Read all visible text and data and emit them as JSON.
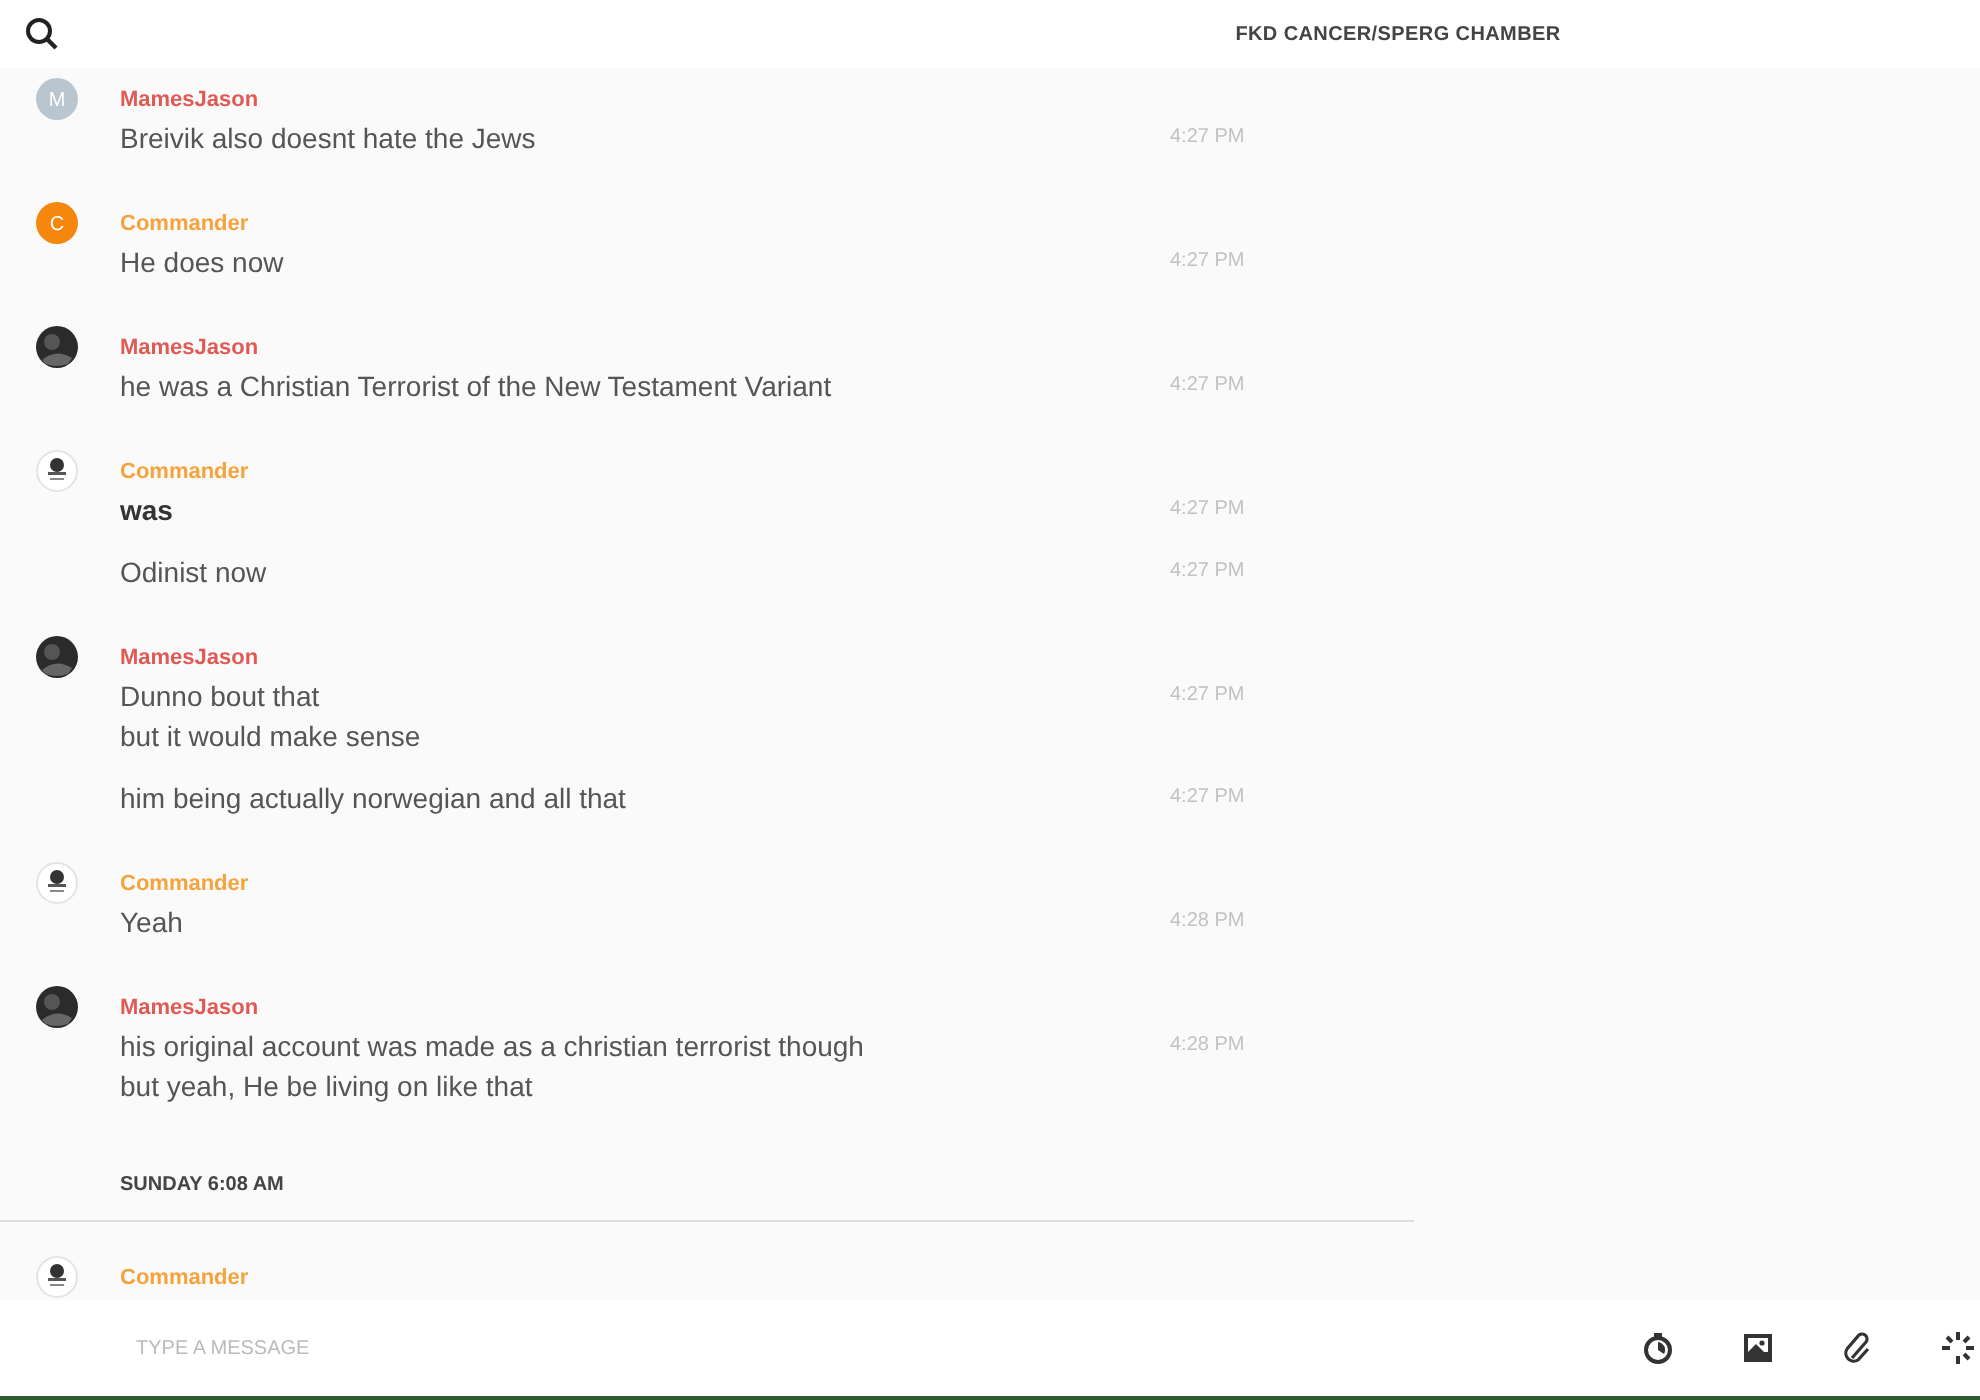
{
  "header": {
    "title": "FKD CANCER/SPERG CHAMBER"
  },
  "messages": [
    {
      "kind": "group",
      "author": "MamesJason",
      "color": "#e05a55",
      "avatar": {
        "kind": "letter",
        "letter": "M",
        "color": "#b9c6cf"
      },
      "lines": [
        {
          "text": "Breivik also doesnt hate the Jews",
          "time": "4:27 PM",
          "bold": false
        }
      ]
    },
    {
      "kind": "group",
      "author": "Commander",
      "color": "#f5a33c",
      "avatar": {
        "kind": "letter",
        "letter": "C",
        "color": "#f5870f"
      },
      "lines": [
        {
          "text": "He does now",
          "time": "4:27 PM",
          "bold": false
        }
      ]
    },
    {
      "kind": "group",
      "author": "MamesJason",
      "color": "#e05a55",
      "avatar": {
        "kind": "photo"
      },
      "lines": [
        {
          "text": "he was a Christian Terrorist of the New Testament Variant",
          "time": "4:27 PM",
          "bold": false
        }
      ]
    },
    {
      "kind": "group",
      "author": "Commander",
      "color": "#f5a33c",
      "avatar": {
        "kind": "emblem"
      },
      "lines": [
        {
          "text": "was",
          "time": "4:27 PM",
          "bold": true
        },
        {
          "text": "Odinist now",
          "time": "4:27 PM",
          "bold": false
        }
      ]
    },
    {
      "kind": "group",
      "author": "MamesJason",
      "color": "#e05a55",
      "avatar": {
        "kind": "photo"
      },
      "lines": [
        {
          "text": "Dunno bout that",
          "time": "4:27 PM",
          "bold": false
        },
        {
          "text": "but it would make sense",
          "bold": false
        },
        {
          "text": "him being actually norwegian and all that",
          "time": "4:27 PM",
          "bold": false
        }
      ]
    },
    {
      "kind": "group",
      "author": "Commander",
      "color": "#f5a33c",
      "avatar": {
        "kind": "emblem"
      },
      "lines": [
        {
          "text": "Yeah",
          "time": "4:28 PM",
          "bold": false
        }
      ]
    },
    {
      "kind": "group",
      "author": "MamesJason",
      "color": "#e05a55",
      "avatar": {
        "kind": "photo"
      },
      "lines": [
        {
          "text": "his original account was made as a christian terrorist though",
          "time": "4:28 PM",
          "bold": false
        },
        {
          "text": "but yeah, He be living on like that",
          "bold": false
        }
      ]
    },
    {
      "kind": "divider",
      "label": "SUNDAY 6:08 AM"
    },
    {
      "kind": "group",
      "author": "Commander",
      "color": "#f5a33c",
      "avatar": {
        "kind": "emblem"
      }
    }
  ],
  "composer": {
    "placeholder": "TYPE A MESSAGE"
  }
}
